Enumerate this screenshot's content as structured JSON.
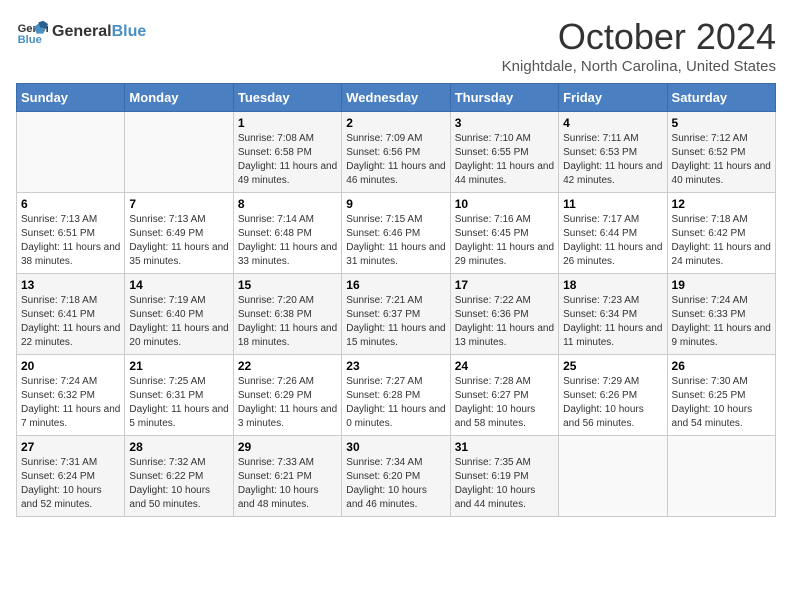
{
  "logo": {
    "line1": "General",
    "line2": "Blue"
  },
  "title": "October 2024",
  "subtitle": "Knightdale, North Carolina, United States",
  "days_of_week": [
    "Sunday",
    "Monday",
    "Tuesday",
    "Wednesday",
    "Thursday",
    "Friday",
    "Saturday"
  ],
  "weeks": [
    [
      {
        "day": "",
        "sunrise": "",
        "sunset": "",
        "daylight": ""
      },
      {
        "day": "",
        "sunrise": "",
        "sunset": "",
        "daylight": ""
      },
      {
        "day": "1",
        "sunrise": "Sunrise: 7:08 AM",
        "sunset": "Sunset: 6:58 PM",
        "daylight": "Daylight: 11 hours and 49 minutes."
      },
      {
        "day": "2",
        "sunrise": "Sunrise: 7:09 AM",
        "sunset": "Sunset: 6:56 PM",
        "daylight": "Daylight: 11 hours and 46 minutes."
      },
      {
        "day": "3",
        "sunrise": "Sunrise: 7:10 AM",
        "sunset": "Sunset: 6:55 PM",
        "daylight": "Daylight: 11 hours and 44 minutes."
      },
      {
        "day": "4",
        "sunrise": "Sunrise: 7:11 AM",
        "sunset": "Sunset: 6:53 PM",
        "daylight": "Daylight: 11 hours and 42 minutes."
      },
      {
        "day": "5",
        "sunrise": "Sunrise: 7:12 AM",
        "sunset": "Sunset: 6:52 PM",
        "daylight": "Daylight: 11 hours and 40 minutes."
      }
    ],
    [
      {
        "day": "6",
        "sunrise": "Sunrise: 7:13 AM",
        "sunset": "Sunset: 6:51 PM",
        "daylight": "Daylight: 11 hours and 38 minutes."
      },
      {
        "day": "7",
        "sunrise": "Sunrise: 7:13 AM",
        "sunset": "Sunset: 6:49 PM",
        "daylight": "Daylight: 11 hours and 35 minutes."
      },
      {
        "day": "8",
        "sunrise": "Sunrise: 7:14 AM",
        "sunset": "Sunset: 6:48 PM",
        "daylight": "Daylight: 11 hours and 33 minutes."
      },
      {
        "day": "9",
        "sunrise": "Sunrise: 7:15 AM",
        "sunset": "Sunset: 6:46 PM",
        "daylight": "Daylight: 11 hours and 31 minutes."
      },
      {
        "day": "10",
        "sunrise": "Sunrise: 7:16 AM",
        "sunset": "Sunset: 6:45 PM",
        "daylight": "Daylight: 11 hours and 29 minutes."
      },
      {
        "day": "11",
        "sunrise": "Sunrise: 7:17 AM",
        "sunset": "Sunset: 6:44 PM",
        "daylight": "Daylight: 11 hours and 26 minutes."
      },
      {
        "day": "12",
        "sunrise": "Sunrise: 7:18 AM",
        "sunset": "Sunset: 6:42 PM",
        "daylight": "Daylight: 11 hours and 24 minutes."
      }
    ],
    [
      {
        "day": "13",
        "sunrise": "Sunrise: 7:18 AM",
        "sunset": "Sunset: 6:41 PM",
        "daylight": "Daylight: 11 hours and 22 minutes."
      },
      {
        "day": "14",
        "sunrise": "Sunrise: 7:19 AM",
        "sunset": "Sunset: 6:40 PM",
        "daylight": "Daylight: 11 hours and 20 minutes."
      },
      {
        "day": "15",
        "sunrise": "Sunrise: 7:20 AM",
        "sunset": "Sunset: 6:38 PM",
        "daylight": "Daylight: 11 hours and 18 minutes."
      },
      {
        "day": "16",
        "sunrise": "Sunrise: 7:21 AM",
        "sunset": "Sunset: 6:37 PM",
        "daylight": "Daylight: 11 hours and 15 minutes."
      },
      {
        "day": "17",
        "sunrise": "Sunrise: 7:22 AM",
        "sunset": "Sunset: 6:36 PM",
        "daylight": "Daylight: 11 hours and 13 minutes."
      },
      {
        "day": "18",
        "sunrise": "Sunrise: 7:23 AM",
        "sunset": "Sunset: 6:34 PM",
        "daylight": "Daylight: 11 hours and 11 minutes."
      },
      {
        "day": "19",
        "sunrise": "Sunrise: 7:24 AM",
        "sunset": "Sunset: 6:33 PM",
        "daylight": "Daylight: 11 hours and 9 minutes."
      }
    ],
    [
      {
        "day": "20",
        "sunrise": "Sunrise: 7:24 AM",
        "sunset": "Sunset: 6:32 PM",
        "daylight": "Daylight: 11 hours and 7 minutes."
      },
      {
        "day": "21",
        "sunrise": "Sunrise: 7:25 AM",
        "sunset": "Sunset: 6:31 PM",
        "daylight": "Daylight: 11 hours and 5 minutes."
      },
      {
        "day": "22",
        "sunrise": "Sunrise: 7:26 AM",
        "sunset": "Sunset: 6:29 PM",
        "daylight": "Daylight: 11 hours and 3 minutes."
      },
      {
        "day": "23",
        "sunrise": "Sunrise: 7:27 AM",
        "sunset": "Sunset: 6:28 PM",
        "daylight": "Daylight: 11 hours and 0 minutes."
      },
      {
        "day": "24",
        "sunrise": "Sunrise: 7:28 AM",
        "sunset": "Sunset: 6:27 PM",
        "daylight": "Daylight: 10 hours and 58 minutes."
      },
      {
        "day": "25",
        "sunrise": "Sunrise: 7:29 AM",
        "sunset": "Sunset: 6:26 PM",
        "daylight": "Daylight: 10 hours and 56 minutes."
      },
      {
        "day": "26",
        "sunrise": "Sunrise: 7:30 AM",
        "sunset": "Sunset: 6:25 PM",
        "daylight": "Daylight: 10 hours and 54 minutes."
      }
    ],
    [
      {
        "day": "27",
        "sunrise": "Sunrise: 7:31 AM",
        "sunset": "Sunset: 6:24 PM",
        "daylight": "Daylight: 10 hours and 52 minutes."
      },
      {
        "day": "28",
        "sunrise": "Sunrise: 7:32 AM",
        "sunset": "Sunset: 6:22 PM",
        "daylight": "Daylight: 10 hours and 50 minutes."
      },
      {
        "day": "29",
        "sunrise": "Sunrise: 7:33 AM",
        "sunset": "Sunset: 6:21 PM",
        "daylight": "Daylight: 10 hours and 48 minutes."
      },
      {
        "day": "30",
        "sunrise": "Sunrise: 7:34 AM",
        "sunset": "Sunset: 6:20 PM",
        "daylight": "Daylight: 10 hours and 46 minutes."
      },
      {
        "day": "31",
        "sunrise": "Sunrise: 7:35 AM",
        "sunset": "Sunset: 6:19 PM",
        "daylight": "Daylight: 10 hours and 44 minutes."
      },
      {
        "day": "",
        "sunrise": "",
        "sunset": "",
        "daylight": ""
      },
      {
        "day": "",
        "sunrise": "",
        "sunset": "",
        "daylight": ""
      }
    ]
  ]
}
